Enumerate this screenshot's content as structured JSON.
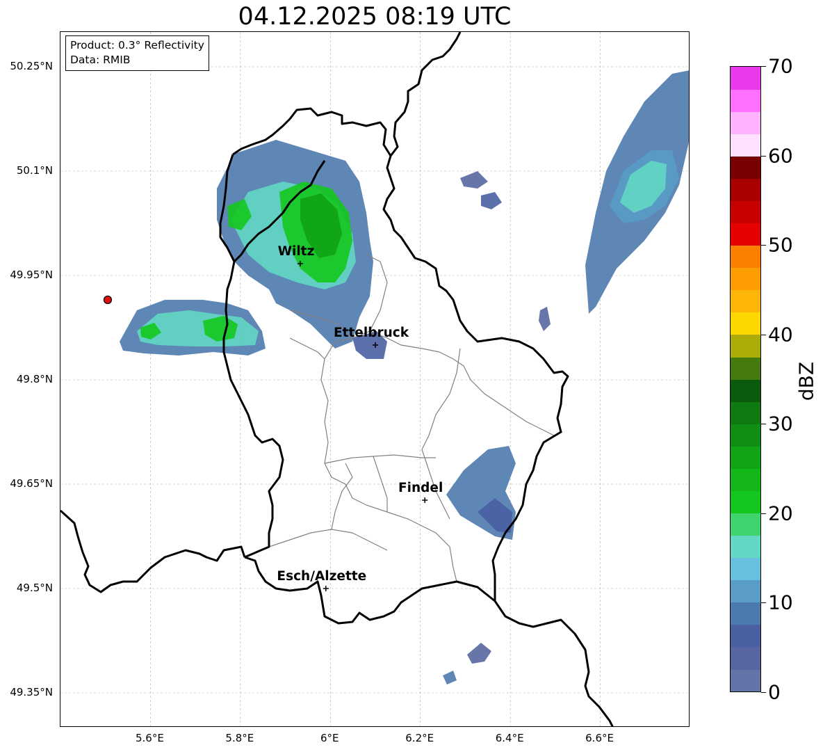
{
  "title": "04.12.2025 08:19 UTC",
  "info_box": {
    "product": "Product: 0.3° Reflectivity",
    "data": "Data: RMIB"
  },
  "map": {
    "lon_range": [
      5.4,
      6.8
    ],
    "lat_range": [
      49.3,
      50.3
    ],
    "lat_ticks": [
      {
        "value": 50.25,
        "label": "50.25°N"
      },
      {
        "value": 50.1,
        "label": "50.1°N"
      },
      {
        "value": 49.95,
        "label": "49.95°N"
      },
      {
        "value": 49.8,
        "label": "49.8°N"
      },
      {
        "value": 49.65,
        "label": "49.65°N"
      },
      {
        "value": 49.5,
        "label": "49.5°N"
      },
      {
        "value": 49.35,
        "label": "49.35°N"
      }
    ],
    "lon_ticks": [
      {
        "value": 5.6,
        "label": "5.6°E"
      },
      {
        "value": 5.8,
        "label": "5.8°E"
      },
      {
        "value": 6.0,
        "label": "6°E"
      },
      {
        "value": 6.2,
        "label": "6.2°E"
      },
      {
        "value": 6.4,
        "label": "6.4°E"
      },
      {
        "value": 6.6,
        "label": "6.6°E"
      }
    ],
    "cities": [
      {
        "name": "Wiltz",
        "lon": 5.933,
        "lat": 49.967
      },
      {
        "name": "Ettelbruck",
        "lon": 6.1,
        "lat": 49.85
      },
      {
        "name": "Findel",
        "lon": 6.21,
        "lat": 49.627
      },
      {
        "name": "Esch/Alzette",
        "lon": 5.99,
        "lat": 49.5
      }
    ],
    "radar_site": {
      "lon": 5.505,
      "lat": 49.915,
      "color": "#dd1111"
    },
    "gridline_color": "#aaaaaa",
    "country_border_color": "#000000",
    "district_border_color": "#808080"
  },
  "colorbar": {
    "label": "dBZ",
    "min": 0,
    "max": 70,
    "ticks": [
      "0",
      "10",
      "20",
      "30",
      "40",
      "50",
      "60",
      "70"
    ],
    "colors": [
      "#6375a8",
      "#5766a0",
      "#4a60a3",
      "#4c7aae",
      "#599cc6",
      "#67c1de",
      "#62d7c3",
      "#3fd46d",
      "#14c71e",
      "#13b71a",
      "#11a415",
      "#108e13",
      "#0e7a10",
      "#0a5c0c",
      "#457a0e",
      "#acac08",
      "#ffd700",
      "#fdb607",
      "#fd9d02",
      "#fd7f00",
      "#e60000",
      "#c80000",
      "#a80000",
      "#780000",
      "#ffe0ff",
      "#ffb3ff",
      "#ff70ff",
      "#ea38ea"
    ]
  }
}
